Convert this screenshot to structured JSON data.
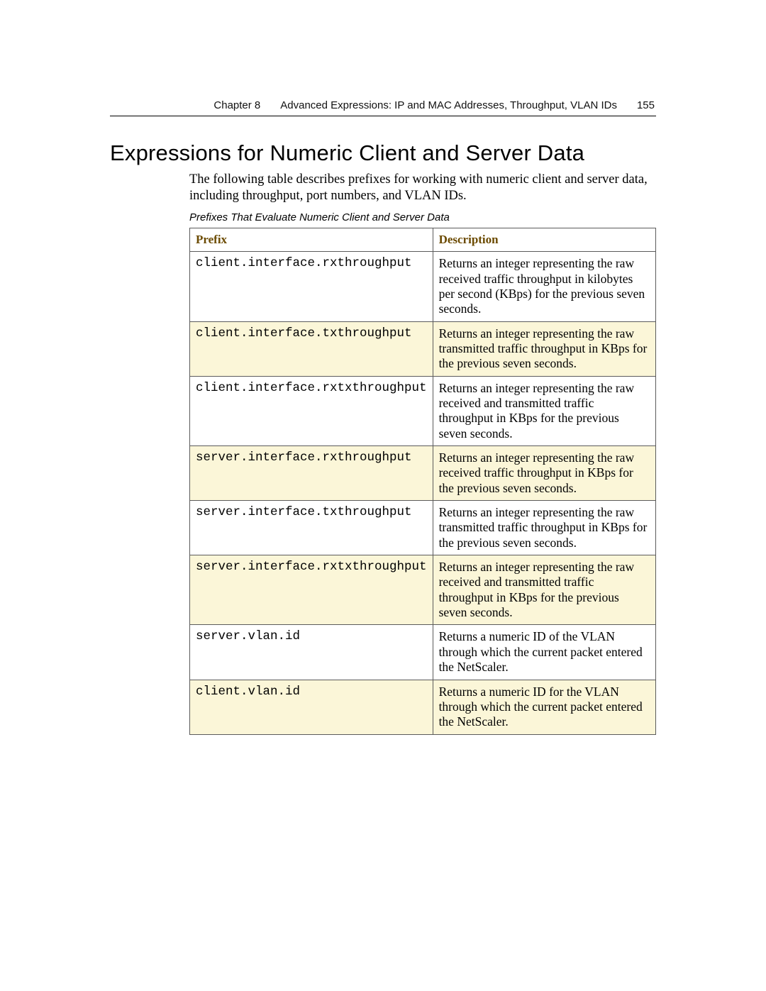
{
  "header": {
    "chapter": "Chapter 8",
    "title": "Advanced Expressions: IP and MAC Addresses, Throughput, VLAN IDs",
    "page": "155"
  },
  "heading": "Expressions for Numeric Client and Server Data",
  "intro": "The following table describes prefixes for working with numeric client and server data, including throughput, port numbers, and VLAN IDs.",
  "caption": "Prefixes That Evaluate Numeric Client and Server Data",
  "columns": {
    "c1": "Prefix",
    "c2": "Description"
  },
  "rows": [
    {
      "prefix": "client.interface.rxthroughput",
      "desc": "Returns an integer representing the raw received traffic throughput in kilobytes per second (KBps) for the previous seven seconds."
    },
    {
      "prefix": "client.interface.txthroughput",
      "desc": "Returns an integer representing the raw transmitted traffic throughput in KBps for the previous seven seconds."
    },
    {
      "prefix": "client.interface.rxtxthroughput",
      "desc": "Returns an integer representing the raw received and transmitted traffic throughput in KBps for the previous seven seconds."
    },
    {
      "prefix": "server.interface.rxthroughput",
      "desc": "Returns an integer representing the raw received traffic throughput in KBps for the previous seven seconds."
    },
    {
      "prefix": "server.interface.txthroughput",
      "desc": "Returns an integer representing the raw transmitted traffic throughput in KBps for the previous seven seconds."
    },
    {
      "prefix": "server.interface.rxtxthroughput",
      "desc": "Returns an integer representing the raw received and transmitted traffic throughput in KBps for the previous seven seconds."
    },
    {
      "prefix": "server.vlan.id",
      "desc": "Returns a numeric ID of the VLAN through which the current packet entered the NetScaler."
    },
    {
      "prefix": "client.vlan.id",
      "desc": "Returns a numeric ID for the VLAN through which the current packet entered the NetScaler."
    }
  ]
}
